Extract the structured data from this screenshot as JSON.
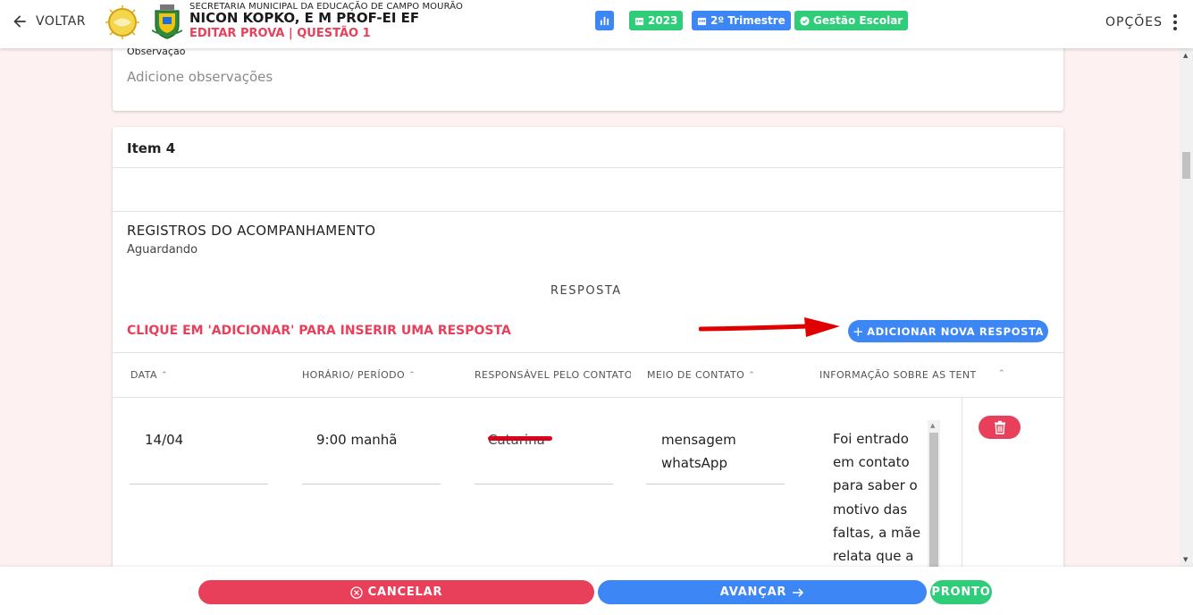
{
  "header": {
    "back_label": "VOLTAR",
    "subtitle": "SECRETARIA MUNICIPAL DA EDUCAÇÃO DE CAMPO MOURÃO",
    "title": "NICON KOPKO, E M PROF-EI EF",
    "subheading": "EDITAR PROVA | QUESTÃO 1",
    "chips": {
      "year": "2023",
      "term": "2º Trimestre",
      "module": "Gestão Escolar"
    },
    "options_label": "OPÇÕES"
  },
  "observation": {
    "label": "Observação",
    "placeholder": "Adicione observações"
  },
  "item": {
    "title": "Item 4",
    "records_title": "REGISTROS DO ACOMPANHAMENTO",
    "records_status": "Aguardando",
    "response_heading": "RESPOSTA",
    "hint": "CLIQUE EM 'ADICIONAR' PARA INSERIR UMA RESPOSTA",
    "add_button": "ADICIONAR NOVA RESPOSTA"
  },
  "table": {
    "columns": [
      "DATA",
      "HORÁRIO/ PERÍODO",
      "RESPONSÁVEL PELO CONTATO",
      "MEIO DE CONTATO",
      "INFORMAÇÃO SOBRE AS TENTATIVAS",
      ""
    ],
    "rows": [
      {
        "data": "14/04",
        "horario": "9:00 manhã",
        "responsavel": "Catarina",
        "meio": "mensagem whatsApp",
        "informacao": "Foi entrado em contato para saber o motivo das faltas, a mãe relata que a"
      }
    ]
  },
  "footer": {
    "cancel": "CANCELAR",
    "next": "AVANÇAR",
    "done": "PRONTO"
  },
  "colors": {
    "primary_blue": "#3d86f5",
    "danger_red": "#e8405a",
    "success_green": "#2fcc7a",
    "page_bg": "#fdf1f1"
  }
}
